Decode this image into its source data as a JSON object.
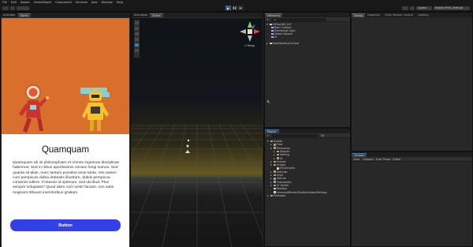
{
  "menu": [
    "File",
    "Edit",
    "Assets",
    "GameObject",
    "Component",
    "Services",
    "Jobs",
    "Window",
    "Help"
  ],
  "toolbar": {
    "layers": "Layers",
    "layout": "Mobile (FHD_Vertical)",
    "play": "▶",
    "pause": "❚❚",
    "step": "▶|"
  },
  "left_panel": {
    "tabs": [
      "Animator",
      "Game"
    ],
    "game_bar": {
      "mode": "Game",
      "display": "Display 1",
      "resolution": "FHD_Vertical (1080x1920)",
      "scale_label": "Scale",
      "scale_value": "0.41x",
      "play_focused": "Play Focused"
    },
    "card": {
      "title": "Quamquam",
      "body": "Quamquam ab iis philosophiam et omnes ingenuas disciplinas habemus; Sed in rebus apertissimis nimium longi sumus. Sed quanta sit alias, nunc tantum possitne esse tanta. Vos autem cum perspicuis dubia debeatis illustrare, dubiis perspicua conamini tollere. Fortasse id optimum, sed ubi illud: Plus semper voluptatis? Quod idem cum vestri faciant, non satis magnam tribuunt inventoribus gratiam.",
      "button": "Button"
    },
    "colors": {
      "orange": "#d86f2c",
      "blue": "#3340e8"
    }
  },
  "middle_panel": {
    "tabs": [
      "Animation",
      "Scene"
    ],
    "scene_bar": {
      "center": "Center",
      "local": "Local",
      "view2d": "2D"
    },
    "gizmo_label": "< Persp"
  },
  "hierarchy": {
    "tab": "Hierarchy",
    "add": "+",
    "search_placeholder": "All",
    "items": [
      {
        "label": "UI/Text/NS_01*",
        "depth": 0,
        "kind": "scene"
      },
      {
        "label": "Main Camera",
        "depth": 1,
        "kind": "go"
      },
      {
        "label": "Directional Light",
        "depth": 1,
        "kind": "go"
      },
      {
        "label": "Global Volume",
        "depth": 1,
        "kind": "go"
      },
      {
        "label": "UI",
        "depth": 1,
        "kind": "go"
      },
      {
        "label": "DontDestroyOnLoad",
        "depth": 0,
        "kind": "scene"
      }
    ]
  },
  "right_top": {
    "tabs": [
      "Debug",
      "Inspector",
      "Unity Version Control",
      "Lighting"
    ]
  },
  "project": {
    "tab": "Project",
    "add": "+",
    "badge": "16",
    "tree": [
      {
        "label": "Assets",
        "depth": 0,
        "open": true
      },
      {
        "label": "Font",
        "depth": 1,
        "open": false
      },
      {
        "label": "Resources",
        "depth": 1,
        "open": true
      },
      {
        "label": "Sample",
        "depth": 2,
        "open": false
      },
      {
        "label": "Setting",
        "depth": 2,
        "open": false
      },
      {
        "label": "UI",
        "depth": 2,
        "open": false
      },
      {
        "label": "Scenes",
        "depth": 1,
        "open": false
      },
      {
        "label": "Scripts",
        "depth": 1,
        "open": true
      },
      {
        "label": "UIController",
        "depth": 2,
        "open": false,
        "file": true
      },
      {
        "label": "Settings",
        "depth": 1,
        "open": false
      },
      {
        "label": "Style",
        "depth": 1,
        "open": false
      },
      {
        "label": "Texture",
        "depth": 1,
        "open": false
      },
      {
        "label": "TutorialInfo",
        "depth": 1,
        "open": false
      },
      {
        "label": "UI Toolkit",
        "depth": 1,
        "open": false
      },
      {
        "label": "Readme",
        "depth": 1,
        "open": false,
        "file": true
      },
      {
        "label": "UniversalRenderPipelineGlobalSettings",
        "depth": 1,
        "open": false,
        "file": true
      },
      {
        "label": "Packages",
        "depth": 0,
        "open": false
      }
    ]
  },
  "console": {
    "tab": "Console",
    "buttons": [
      "Clear",
      "Collapse",
      "Error Pause",
      "Editor"
    ]
  }
}
